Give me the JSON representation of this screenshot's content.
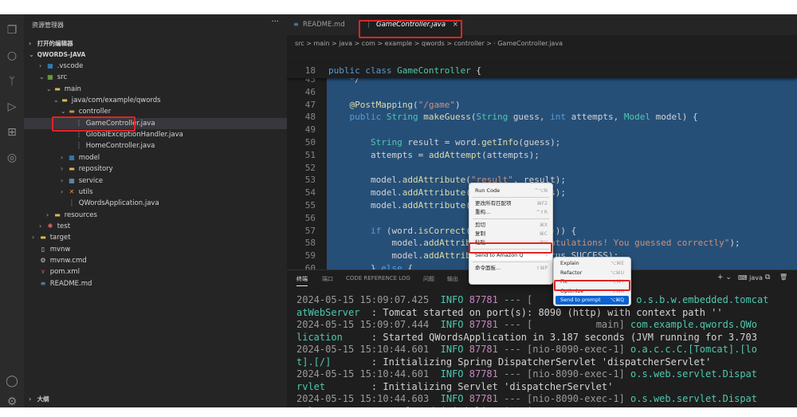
{
  "sidebar": {
    "title": "资源管理器",
    "more": "···",
    "open_editors": "打开的编辑器",
    "project": "QWORDS-JAVA",
    "tree": [
      {
        "label": ".vscode",
        "depth": 1,
        "chev": ">",
        "icon": "▦",
        "color": "#3a96dd"
      },
      {
        "label": "src",
        "depth": 1,
        "chev": "v",
        "icon": "▦",
        "color": "#7fbf4d"
      },
      {
        "label": "main",
        "depth": 2,
        "chev": "v",
        "icon": "▬",
        "color": "#d9b94f"
      },
      {
        "label": "java/com/example/qwords",
        "depth": 3,
        "chev": "v",
        "icon": "▬",
        "color": "#d9b94f"
      },
      {
        "label": "controller",
        "depth": 4,
        "chev": "v",
        "icon": "▬",
        "color": "#c0914f"
      },
      {
        "label": "GameController.java",
        "depth": 5,
        "chev": "",
        "icon": "┆",
        "color": "#888888",
        "selected": true
      },
      {
        "label": "GlobalExceptionHandler.java",
        "depth": 5,
        "chev": "",
        "icon": "┆",
        "color": "#888888"
      },
      {
        "label": "HomeController.java",
        "depth": 5,
        "chev": "",
        "icon": "┆",
        "color": "#888888"
      },
      {
        "label": "model",
        "depth": 4,
        "chev": ">",
        "icon": "▦",
        "color": "#3a96dd"
      },
      {
        "label": "repository",
        "depth": 4,
        "chev": ">",
        "icon": "▬",
        "color": "#d9b94f"
      },
      {
        "label": "service",
        "depth": 4,
        "chev": ">",
        "icon": "▦",
        "color": "#6fa8dc"
      },
      {
        "label": "utils",
        "depth": 4,
        "chev": ">",
        "icon": "✕",
        "color": "#e69138"
      },
      {
        "label": "QWordsApplication.java",
        "depth": 4,
        "chev": "",
        "icon": "┆",
        "color": "#888888"
      },
      {
        "label": "resources",
        "depth": 2,
        "chev": ">",
        "icon": "▬",
        "color": "#d9b94f"
      },
      {
        "label": "test",
        "depth": 1,
        "chev": ">",
        "icon": "✱",
        "color": "#e06666"
      },
      {
        "label": "target",
        "depth": 0,
        "chev": ">",
        "icon": "▬",
        "color": "#d9b94f"
      },
      {
        "label": "mvnw",
        "depth": 0,
        "chev": "",
        "icon": "▯",
        "color": "#cccccc"
      },
      {
        "label": "mvnw.cmd",
        "depth": 0,
        "chev": "",
        "icon": "⚙",
        "color": "#cccccc"
      },
      {
        "label": "pom.xml",
        "depth": 0,
        "chev": "",
        "icon": "⋎",
        "color": "#e06666"
      },
      {
        "label": "README.md",
        "depth": 0,
        "chev": "",
        "icon": "≡",
        "color": "#6fa8dc"
      }
    ],
    "outline": "大纲"
  },
  "tabs": [
    {
      "label": "README.md",
      "close": ""
    },
    {
      "label": "GameController.java",
      "close": "×",
      "active": true
    }
  ],
  "breadcrumb": "src > main > java > com > example > qwords > controller > ⸱ GameController.java",
  "code": {
    "sticky": {
      "ln": "18",
      "tokens": [
        [
          "kw",
          "public class "
        ],
        [
          "ty",
          "GameController"
        ],
        [
          "pl",
          " {"
        ]
      ]
    },
    "lines": [
      {
        "ln": "45",
        "tokens": [
          [
            "pl",
            "    */"
          ]
        ]
      },
      {
        "ln": "46",
        "tokens": [
          [
            "pl",
            ""
          ]
        ]
      },
      {
        "ln": "47",
        "tokens": [
          [
            "an",
            "    @PostMapping"
          ],
          [
            "pl",
            "("
          ],
          [
            "st",
            "\"/game\""
          ],
          [
            "pl",
            ")"
          ]
        ]
      },
      {
        "ln": "48",
        "tokens": [
          [
            "kw",
            "    public "
          ],
          [
            "ty",
            "String "
          ],
          [
            "an",
            "makeGuess"
          ],
          [
            "pl",
            "("
          ],
          [
            "ty",
            "String "
          ],
          [
            "pl",
            "guess, "
          ],
          [
            "kw",
            "int "
          ],
          [
            "pl",
            "attempts, "
          ],
          [
            "ty",
            "Model "
          ],
          [
            "pl",
            "model) {"
          ]
        ]
      },
      {
        "ln": "49",
        "tokens": [
          [
            "pl",
            ""
          ]
        ]
      },
      {
        "ln": "50",
        "tokens": [
          [
            "ty",
            "        String "
          ],
          [
            "pl",
            "result = word."
          ],
          [
            "an",
            "getInfo"
          ],
          [
            "pl",
            "(guess);"
          ]
        ]
      },
      {
        "ln": "51",
        "tokens": [
          [
            "pl",
            "        attempts = "
          ],
          [
            "an",
            "addAttempt"
          ],
          [
            "pl",
            "(attempts);"
          ]
        ]
      },
      {
        "ln": "52",
        "tokens": [
          [
            "pl",
            ""
          ]
        ]
      },
      {
        "ln": "53",
        "tokens": [
          [
            "pl",
            "        model."
          ],
          [
            "an",
            "addAttribute"
          ],
          [
            "pl",
            "("
          ],
          [
            "st",
            "\"result\""
          ],
          [
            "pl",
            ", result);"
          ]
        ]
      },
      {
        "ln": "54",
        "tokens": [
          [
            "pl",
            "        model."
          ],
          [
            "an",
            "addAttribute"
          ],
          [
            "pl",
            "(\""
          ],
          [
            "pl",
            "             ts);"
          ]
        ]
      },
      {
        "ln": "55",
        "tokens": [
          [
            "pl",
            "        model."
          ],
          [
            "an",
            "addAttribute"
          ],
          [
            "pl",
            "(\""
          ]
        ]
      },
      {
        "ln": "56",
        "tokens": [
          [
            "pl",
            ""
          ]
        ]
      },
      {
        "ln": "57",
        "tokens": [
          [
            "kw",
            "        if "
          ],
          [
            "pl",
            "(word."
          ],
          [
            "an",
            "isCorrect"
          ],
          [
            "pl",
            "(g              ))) {"
          ]
        ]
      },
      {
        "ln": "58",
        "tokens": [
          [
            "pl",
            "            model."
          ],
          [
            "an",
            "addAttribu"
          ],
          [
            "pl",
            "           "
          ],
          [
            "st",
            "ngratulations! You guessed correctly\""
          ],
          [
            "pl",
            ");"
          ]
        ]
      },
      {
        "ln": "59",
        "tokens": [
          [
            "pl",
            "            model."
          ],
          [
            "an",
            "addAttribu"
          ],
          [
            "pl",
            "           Status.SUCCESS);"
          ]
        ]
      },
      {
        "ln": "60",
        "tokens": [
          [
            "pl",
            "        } "
          ],
          [
            "kw",
            "else "
          ],
          [
            "pl",
            "{"
          ]
        ]
      }
    ]
  },
  "panel": {
    "tabs": [
      "终端",
      "端口",
      "CODE REFERENCE LOG",
      "问题",
      "输出"
    ],
    "plus": "+ ⌄",
    "terminal_name": "java",
    "split": "⧉",
    "trash": "🗑",
    "logs": [
      [
        [
          "log-ts",
          "2024-05-15 15:09:07.425  "
        ],
        [
          "log-info",
          "INFO "
        ],
        [
          "log-pid",
          "87781"
        ],
        [
          "log-thread",
          " --- [               n] "
        ],
        [
          "log-cls",
          "o.s.b.w.embedded.tomcat"
        ]
      ],
      [
        [
          "log-cls",
          "atWebServer"
        ],
        [
          "pl",
          "  : Tomcat started on port(s): 8090 (http) with context path ''"
        ]
      ],
      [
        [
          "log-ts",
          "2024-05-15 15:09:07.444  "
        ],
        [
          "log-info",
          "INFO "
        ],
        [
          "log-pid",
          "87781"
        ],
        [
          "log-thread",
          " --- [           main] "
        ],
        [
          "log-cls",
          "com.example.qwords.QWo"
        ]
      ],
      [
        [
          "log-cls",
          "lication"
        ],
        [
          "pl",
          "     : Started QWordsApplication in 3.187 seconds (JVM running for 3.703"
        ]
      ],
      [
        [
          "log-ts",
          "2024-05-15 15:10:44.601  "
        ],
        [
          "log-info",
          "INFO "
        ],
        [
          "log-pid",
          "87781"
        ],
        [
          "log-thread",
          " --- [nio-8090-exec-1] "
        ],
        [
          "log-cls",
          "o.a.c.c.C.[Tomcat].[lo"
        ]
      ],
      [
        [
          "log-cls",
          "t].[/]"
        ],
        [
          "pl",
          "       : Initializing Spring DispatcherServlet 'dispatcherServlet'"
        ]
      ],
      [
        [
          "log-ts",
          "2024-05-15 15:10:44.601  "
        ],
        [
          "log-info",
          "INFO "
        ],
        [
          "log-pid",
          "87781"
        ],
        [
          "log-thread",
          " --- [nio-8090-exec-1] "
        ],
        [
          "log-cls",
          "o.s.web.servlet.Dispat"
        ]
      ],
      [
        [
          "log-cls",
          "rvlet"
        ],
        [
          "pl",
          "        : Initializing Servlet 'dispatcherServlet'"
        ]
      ],
      [
        [
          "log-ts",
          "2024-05-15 15:10:44.603  "
        ],
        [
          "log-info",
          "INFO "
        ],
        [
          "log-pid",
          "87781"
        ],
        [
          "log-thread",
          " --- [nio-8090-exec-1] "
        ],
        [
          "log-cls",
          "o.s.web.servlet.Dispat"
        ]
      ],
      [
        [
          "log-cls",
          "rvlet"
        ],
        [
          "pl",
          "        : Completed initialization in 2 ms"
        ]
      ]
    ]
  },
  "context_menu": {
    "items": [
      {
        "label": "Run Code",
        "shortcut": "^⌥N"
      },
      {
        "sep": true
      },
      {
        "label": "更改所有匹配项",
        "shortcut": "⌘F2"
      },
      {
        "label": "重构...",
        "shortcut": "^⇧R"
      },
      {
        "sep": true
      },
      {
        "label": "剪切",
        "shortcut": "⌘X"
      },
      {
        "label": "复制",
        "shortcut": "⌘C"
      },
      {
        "label": "粘贴",
        "shortcut": "⌘V"
      },
      {
        "sep": true
      },
      {
        "label": "Send to Amazon Q",
        "shortcut": "›",
        "highlight": true
      },
      {
        "sep": true
      },
      {
        "label": "命令面板...",
        "shortcut": "⇧⌘P"
      }
    ]
  },
  "sub_menu": {
    "items": [
      {
        "label": "Explain",
        "shortcut": "⌥⌘E"
      },
      {
        "label": "Refactor",
        "shortcut": "⌥⌘U"
      },
      {
        "label": "Fix",
        "shortcut": "⌥⌘Y"
      },
      {
        "label": "Optimize",
        "shortcut": "⌥⌘A"
      },
      {
        "label": "Send to prompt",
        "shortcut": "⌥⌘Q",
        "active": true
      }
    ]
  },
  "activity_icons": [
    "files-icon",
    "search-icon",
    "source-control-icon",
    "run-debug-icon",
    "extensions-icon",
    "amazon-q-icon",
    "account-icon",
    "settings-icon"
  ]
}
